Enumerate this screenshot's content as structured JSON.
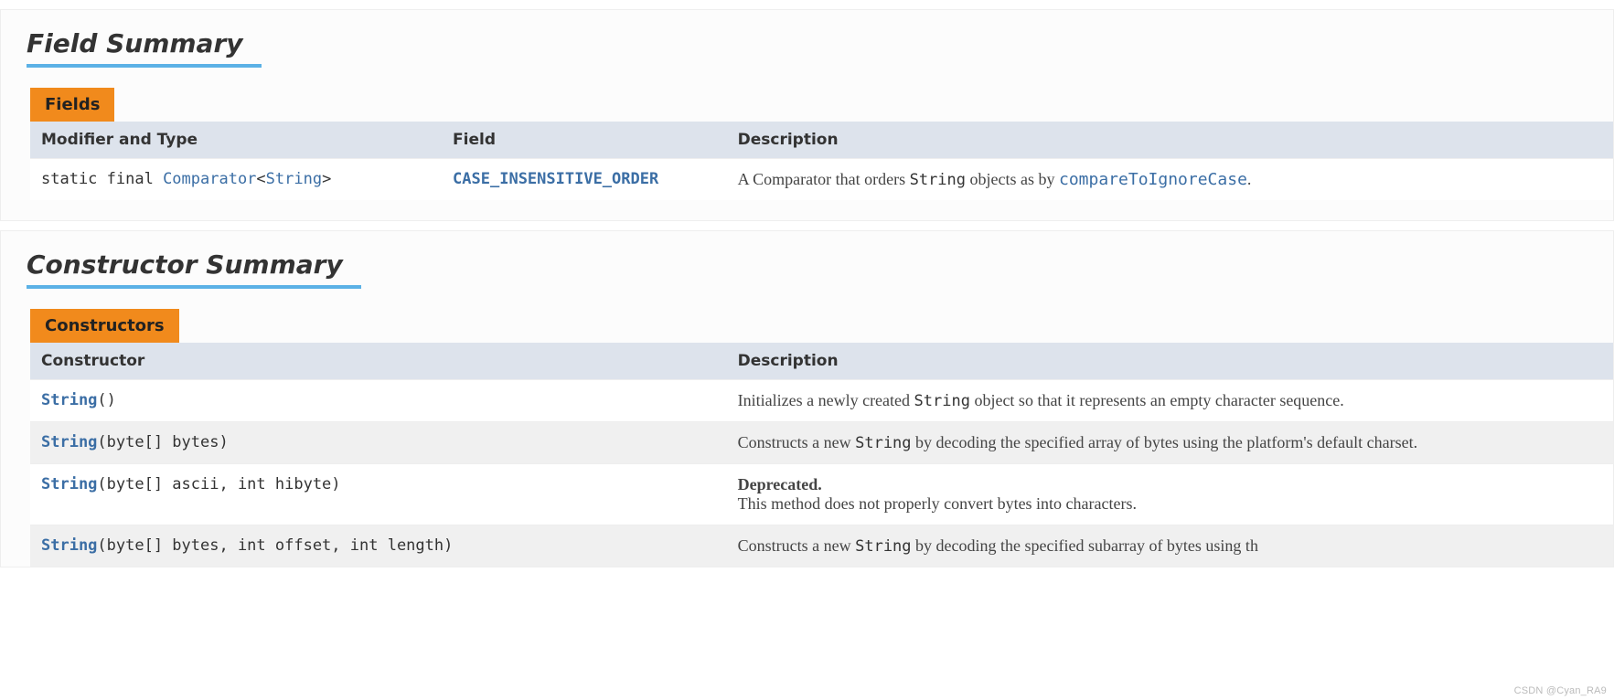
{
  "fieldSummary": {
    "heading": "Field Summary",
    "caption": "Fields",
    "headers": {
      "modifierType": "Modifier and Type",
      "field": "Field",
      "description": "Description"
    },
    "row": {
      "modifierPrefix": "static final ",
      "typeLink1": "Comparator",
      "lt": "<",
      "typeLink2": "String",
      "gt": ">",
      "fieldName": "CASE_INSENSITIVE_ORDER",
      "descPre": "A Comparator that orders ",
      "code1": "String",
      "descMid": " objects as by ",
      "link1": "compareToIgnoreCase",
      "descPost": "."
    }
  },
  "constructorSummary": {
    "heading": "Constructor Summary",
    "caption": "Constructors",
    "headers": {
      "constructor": "Constructor",
      "description": "Description"
    },
    "rows": [
      {
        "sigLink": "String",
        "sigRest": "()",
        "descPre": "Initializes a newly created ",
        "code1": "String",
        "descPost": " object so that it represents an empty character sequence."
      },
      {
        "sigLink": "String",
        "sigRest": "(byte[] bytes)",
        "descPre": "Constructs a new ",
        "code1": "String",
        "descPost": " by decoding the specified array of bytes using the platform's default charset."
      },
      {
        "sigLink": "String",
        "sigRest": "(byte[] ascii, int hibyte)",
        "deprecatedLabel": "Deprecated.",
        "deprecatedText": "This method does not properly convert bytes into characters."
      },
      {
        "sigLink": "String",
        "sigRest": "(byte[] bytes, int offset, int length)",
        "descPre": "Constructs a new ",
        "code1": "String",
        "descPost": " by decoding the specified subarray of bytes using th"
      }
    ]
  },
  "watermark": "CSDN @Cyan_RA9"
}
